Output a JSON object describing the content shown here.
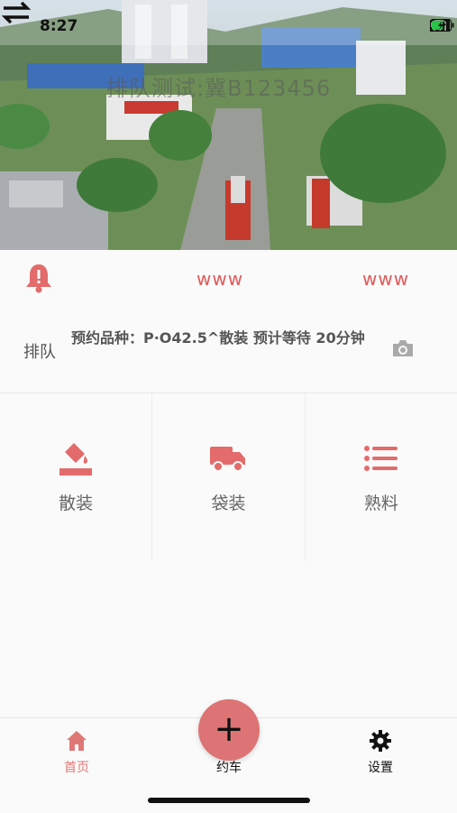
{
  "status_bar": {
    "time": "8:27"
  },
  "hero": {
    "overlay_text": "排队测试:冀B123456"
  },
  "notice": {
    "items": [
      "www",
      "www"
    ]
  },
  "queue": {
    "label": "排队",
    "info": "预约品种：P·O42.5^散装 预计等待 20分钟"
  },
  "categories": [
    {
      "label": "散装",
      "icon": "bulk-fill-icon"
    },
    {
      "label": "袋装",
      "icon": "truck-icon"
    },
    {
      "label": "熟料",
      "icon": "list-icon"
    }
  ],
  "tabbar": {
    "home": "首页",
    "book": "约车",
    "settings": "设置"
  },
  "colors": {
    "accent": "#e35858",
    "fab": "#dd7374"
  }
}
